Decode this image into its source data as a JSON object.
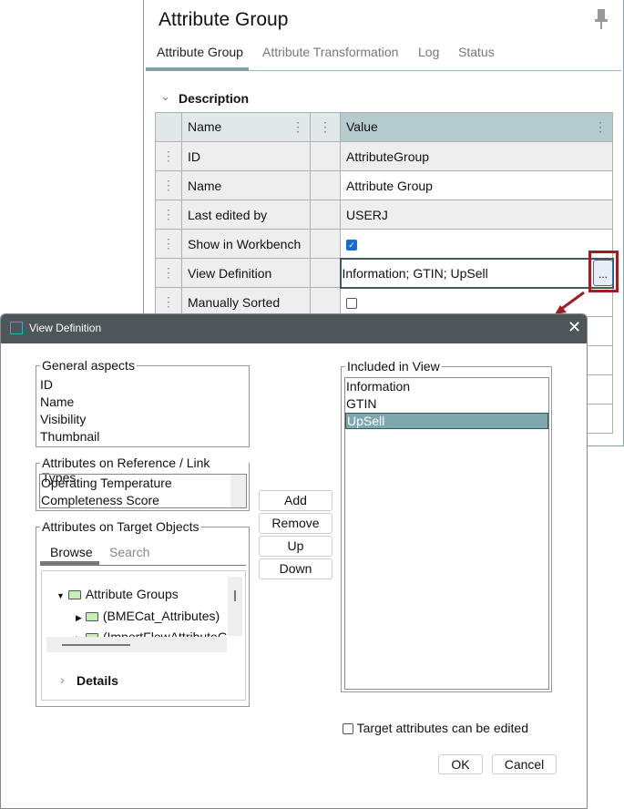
{
  "panel": {
    "title": "Attribute Group",
    "tabs": [
      "Attribute Group",
      "Attribute Transformation",
      "Log",
      "Status"
    ],
    "section": "Description",
    "columns": {
      "name": "Name",
      "value": "Value"
    },
    "rows": [
      {
        "name": "ID",
        "value": "AttributeGroup"
      },
      {
        "name": "Name",
        "value": "Attribute Group"
      },
      {
        "name": "Last edited by",
        "value": "USERJ"
      },
      {
        "name": "Show in Workbench",
        "checked": true
      },
      {
        "name": "View Definition",
        "value": "Information; GTIN; UpSell",
        "button": "..."
      },
      {
        "name": "Manually Sorted",
        "checked": false
      }
    ]
  },
  "dialog": {
    "title": "View Definition",
    "general": {
      "legend": "General aspects",
      "items": [
        "ID",
        "Name",
        "Visibility",
        "Thumbnail"
      ]
    },
    "reference": {
      "legend": "Attributes on Reference / Link Types",
      "items": [
        "Operating Temperature",
        "Completeness Score"
      ]
    },
    "target": {
      "legend": "Attributes on Target Objects",
      "tabs": [
        "Browse",
        "Search"
      ],
      "tree": [
        "Attribute Groups",
        "(BMECat_Attributes)",
        "(ImportFlowAttributeG"
      ],
      "details": "Details"
    },
    "buttons": {
      "add": "Add",
      "remove": "Remove",
      "up": "Up",
      "down": "Down",
      "ok": "OK",
      "cancel": "Cancel"
    },
    "included": {
      "legend": "Included in View",
      "items": [
        "Information",
        "GTIN",
        "UpSell"
      ],
      "selected": "UpSell"
    },
    "checkbox": {
      "label": "Target attributes can be edited",
      "checked": false
    }
  },
  "colors": {
    "accent": "#7fa3a8",
    "selection": "#7fa8ae",
    "titlebar": "#4d5659",
    "highlight": "#a01e23"
  }
}
